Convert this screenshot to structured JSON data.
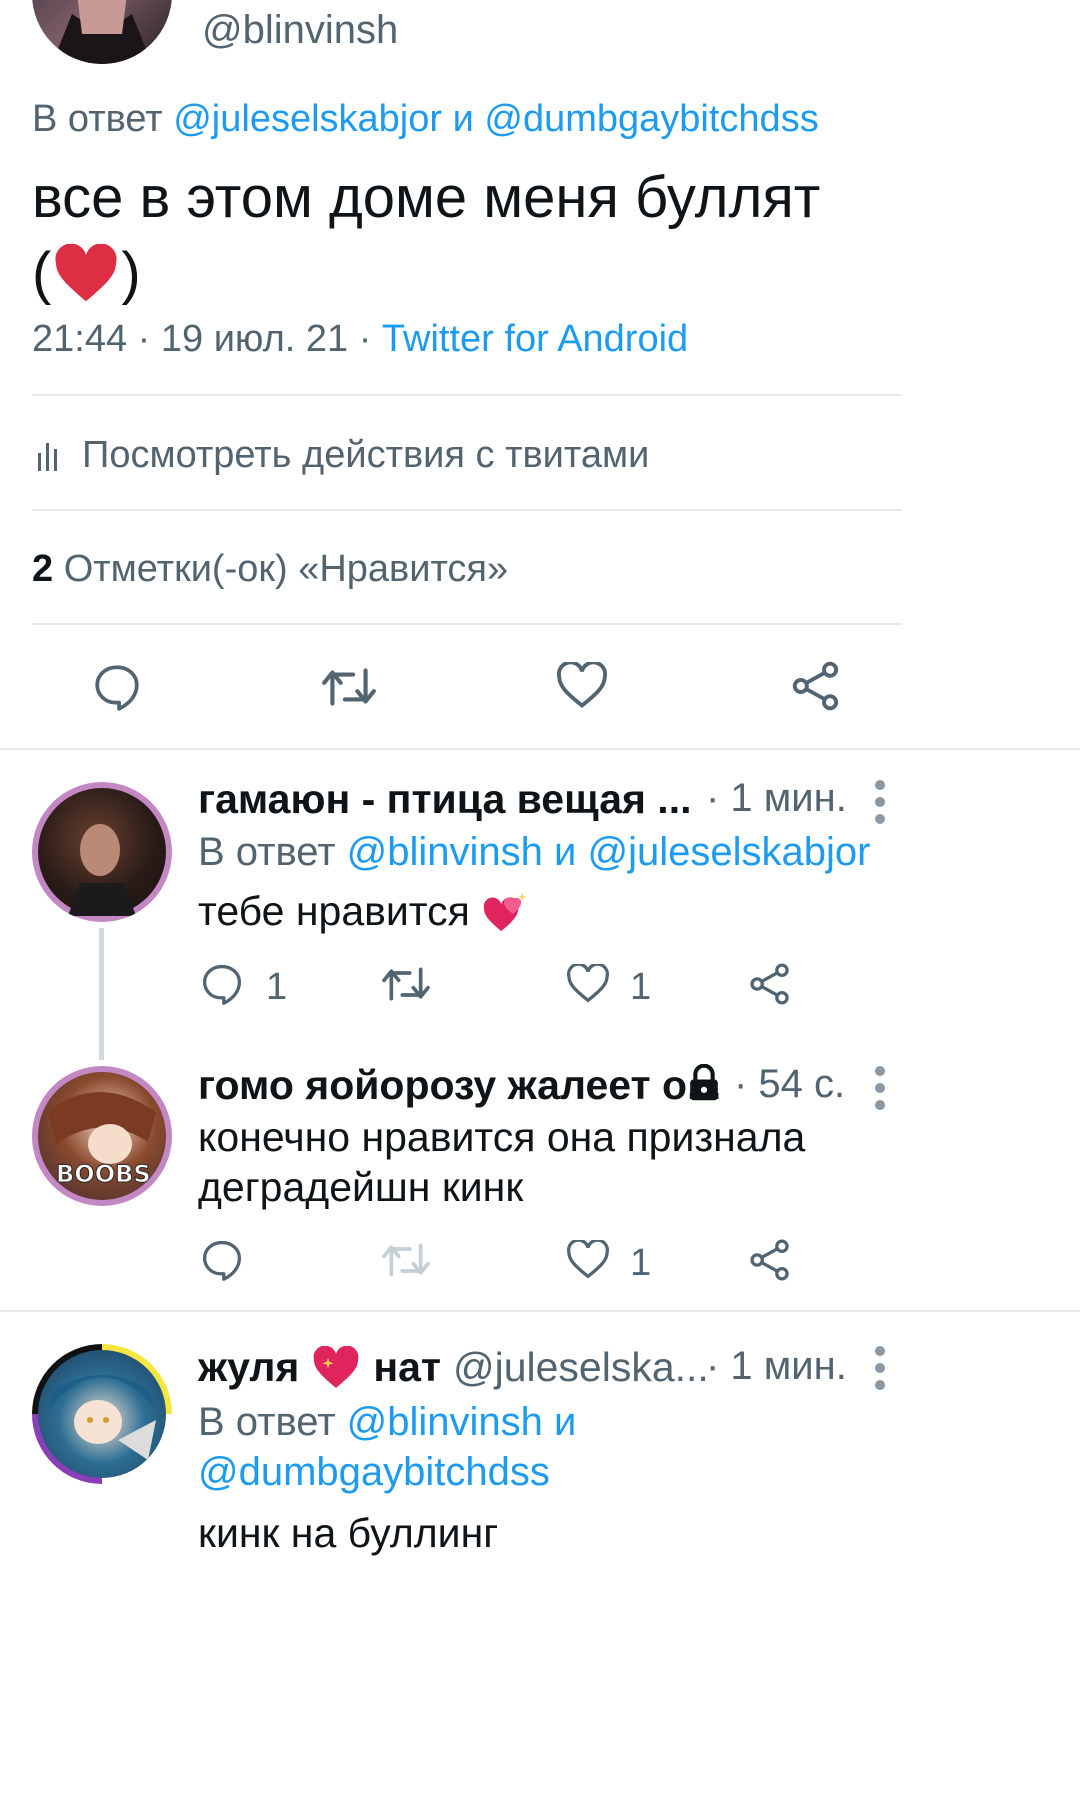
{
  "main_tweet": {
    "handle": "@blinvinsh",
    "reply_prefix": "В ответ",
    "reply_user1": "@juleselskabjor",
    "reply_and": "и",
    "reply_user2": "@dumbgaybitchdss",
    "text_line1": "все в этом доме меня буллят",
    "text_line2_open": "(",
    "text_line2_close": ")",
    "timestamp": "21:44 · 19 июл. 21 ·",
    "source": "Twitter for Android",
    "activity_label": "Посмотреть действия с твитами",
    "likes_count": "2",
    "likes_label": "Отметки(-ок) «Нравится»"
  },
  "replies": [
    {
      "name": "гамаюн - птица вещая ...",
      "time": "· 1 мин.",
      "reply_prefix": "В ответ",
      "reply_user1": "@blinvinsh",
      "reply_and": "и",
      "reply_user2": "@juleselskabjor",
      "text": "тебе нравится",
      "reply_count": "1",
      "like_count": "1"
    },
    {
      "name": "гомо яойорозу жалеет о...",
      "time": "· 54 с.",
      "text_line1": "конечно нравится она признала",
      "text_line2": "деградейшн кинк",
      "like_count": "1",
      "avatar_text": "BOOBS"
    },
    {
      "name_part1": "жуля",
      "name_part2": "нат",
      "handle": "@juleselska...",
      "time": "· 1 мин.",
      "reply_prefix": "В ответ",
      "reply_user1": "@blinvinsh",
      "reply_and": "и",
      "reply_user2": "@dumbgaybitchdss",
      "text": "кинк на буллинг"
    }
  ],
  "colors": {
    "accent": "#1d9bf0",
    "secondary_text": "#536471",
    "divider": "#e6e9ec",
    "heart": "#e0245e"
  },
  "icons": [
    "reply-icon",
    "retweet-icon",
    "like-icon",
    "share-icon",
    "more-icon",
    "lock-icon",
    "analytics-icon",
    "heart-emoji",
    "sparkling-heart-emoji"
  ]
}
